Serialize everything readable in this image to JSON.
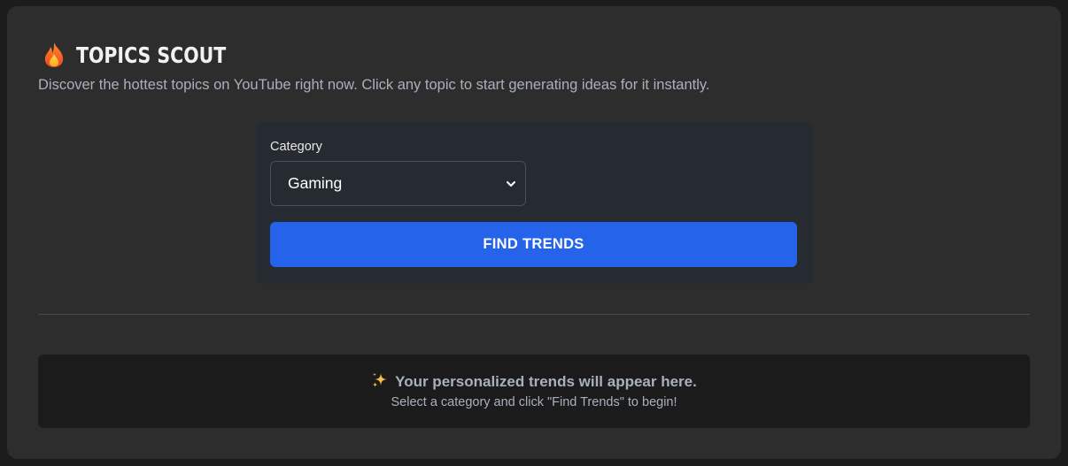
{
  "header": {
    "icon": "fire-icon",
    "title": "TOPICS SCOUT",
    "subtitle": "Discover the hottest topics on YouTube right now. Click any topic to start generating ideas for it instantly."
  },
  "form": {
    "category_label": "Category",
    "category_selected": "Gaming",
    "find_button_label": "FIND TRENDS"
  },
  "results": {
    "icon": "sparkles-icon",
    "heading": "Your personalized trends will appear here.",
    "hint": "Select a category and click \"Find Trends\" to begin!"
  },
  "colors": {
    "background": "#1c1c1c",
    "card": "#2d2d2d",
    "panel": "#262a31",
    "accent_button": "#2563eb",
    "results_box": "#1b1b1b",
    "muted_text": "#a9b0bd"
  }
}
